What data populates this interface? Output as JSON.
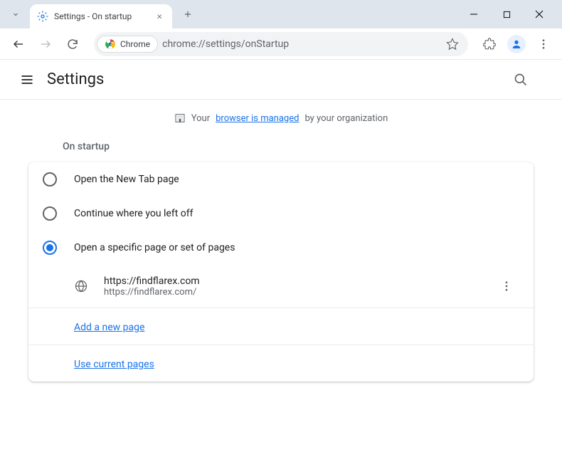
{
  "titlebar": {
    "tab_title": "Settings - On startup"
  },
  "toolbar": {
    "chrome_label": "Chrome",
    "url": "chrome://settings/onStartup"
  },
  "header": {
    "title": "Settings"
  },
  "banner": {
    "prefix": "Your ",
    "link": "browser is managed",
    "suffix": " by your organization"
  },
  "section": {
    "title": "On startup",
    "options": {
      "new_tab": "Open the New Tab page",
      "continue": "Continue where you left off",
      "specific": "Open a specific page or set of pages"
    },
    "page": {
      "title": "https://findflarex.com",
      "url": "https://findflarex.com/"
    },
    "add_link": "Add a new page",
    "use_current": "Use current pages"
  }
}
